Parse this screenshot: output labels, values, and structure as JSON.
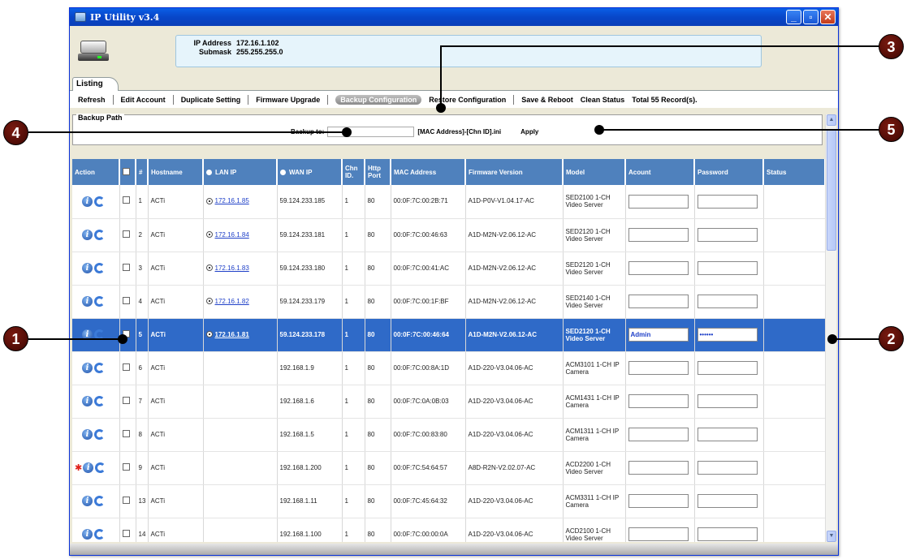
{
  "window": {
    "title": "IP Utility v3.4",
    "minimize": "_",
    "maximize": "▫",
    "close": "✕"
  },
  "header": {
    "ip_label": "IP Address",
    "ip_value": "172.16.1.102",
    "mask_label": "Submask",
    "mask_value": "255.255.255.0"
  },
  "tabs": [
    {
      "label": "Listing"
    }
  ],
  "toolbar": {
    "items": [
      {
        "label": "Refresh"
      },
      {
        "label": "Edit Account"
      },
      {
        "label": "Duplicate Setting"
      },
      {
        "label": "Firmware Upgrade"
      },
      {
        "label": "Backup Configuration"
      },
      {
        "label": "Restore Configuration"
      },
      {
        "label": "Save & Reboot"
      },
      {
        "label": "Clean Status"
      }
    ],
    "active_item": "Backup Configuration",
    "total": "Total 55 Record(s)."
  },
  "backup": {
    "legend": "Backup Path",
    "backup_to_label": "Backup to:",
    "backup_to_value": "",
    "suffix": "[MAC Address]-[Chn ID].ini",
    "apply_label": "Apply"
  },
  "table": {
    "headers": [
      "Action",
      "",
      "#",
      "Hostname",
      "LAN IP",
      "WAN IP",
      "Chn ID.",
      "Http Port",
      "MAC Address",
      "Firmware Version",
      "Model",
      "Acount",
      "Password",
      "Status"
    ],
    "rows": [
      {
        "num": "1",
        "host": "ACTi",
        "lan": "172.16.1.85",
        "wan": "59.124.233.185",
        "chn": "1",
        "port": "80",
        "mac": "00:0F:7C:00:2B:71",
        "fw": "A1D-P0V-V1.04.17-AC",
        "model": "SED2100 1-CH Video Server",
        "account": "",
        "password": "",
        "status": "",
        "selected": false,
        "star": false
      },
      {
        "num": "2",
        "host": "ACTi",
        "lan": "172.16.1.84",
        "wan": "59.124.233.181",
        "chn": "1",
        "port": "80",
        "mac": "00:0F:7C:00:46:63",
        "fw": "A1D-M2N-V2.06.12-AC",
        "model": "SED2120 1-CH Video Server",
        "account": "",
        "password": "",
        "status": "",
        "selected": false,
        "star": false
      },
      {
        "num": "3",
        "host": "ACTi",
        "lan": "172.16.1.83",
        "wan": "59.124.233.180",
        "chn": "1",
        "port": "80",
        "mac": "00:0F:7C:00:41:AC",
        "fw": "A1D-M2N-V2.06.12-AC",
        "model": "SED2120 1-CH Video Server",
        "account": "",
        "password": "",
        "status": "",
        "selected": false,
        "star": false
      },
      {
        "num": "4",
        "host": "ACTi",
        "lan": "172.16.1.82",
        "wan": "59.124.233.179",
        "chn": "1",
        "port": "80",
        "mac": "00:0F:7C:00:1F:BF",
        "fw": "A1D-M2N-V2.06.12-AC",
        "model": "SED2140 1-CH Video Server",
        "account": "",
        "password": "",
        "status": "",
        "selected": false,
        "star": false
      },
      {
        "num": "5",
        "host": "ACTi",
        "lan": "172.16.1.81",
        "wan": "59.124.233.178",
        "chn": "1",
        "port": "80",
        "mac": "00:0F:7C:00:46:64",
        "fw": "A1D-M2N-V2.06.12-AC",
        "model": "SED2120 1-CH Video Server",
        "account": "Admin",
        "password": "••••••",
        "status": "",
        "selected": true,
        "star": false
      },
      {
        "num": "6",
        "host": "ACTi",
        "lan": "",
        "wan": "192.168.1.9",
        "chn": "1",
        "port": "80",
        "mac": "00:0F:7C:00:8A:1D",
        "fw": "A1D-220-V3.04.06-AC",
        "model": "ACM3101 1-CH IP Camera",
        "account": "",
        "password": "",
        "status": "",
        "selected": false,
        "star": false
      },
      {
        "num": "7",
        "host": "ACTi",
        "lan": "",
        "wan": "192.168.1.6",
        "chn": "1",
        "port": "80",
        "mac": "00:0F:7C:0A:0B:03",
        "fw": "A1D-220-V3.04.06-AC",
        "model": "ACM1431 1-CH IP Camera",
        "account": "",
        "password": "",
        "status": "",
        "selected": false,
        "star": false
      },
      {
        "num": "8",
        "host": "ACTi",
        "lan": "",
        "wan": "192.168.1.5",
        "chn": "1",
        "port": "80",
        "mac": "00:0F:7C:00:83:80",
        "fw": "A1D-220-V3.04.06-AC",
        "model": "ACM1311 1-CH IP Camera",
        "account": "",
        "password": "",
        "status": "",
        "selected": false,
        "star": false
      },
      {
        "num": "9",
        "host": "ACTi",
        "lan": "",
        "wan": "192.168.1.200",
        "chn": "1",
        "port": "80",
        "mac": "00:0F:7C:54:64:57",
        "fw": "A8D-R2N-V2.02.07-AC",
        "model": "ACD2200 1-CH Video Server",
        "account": "",
        "password": "",
        "status": "",
        "selected": false,
        "star": true
      },
      {
        "num": "13",
        "host": "ACTi",
        "lan": "",
        "wan": "192.168.1.11",
        "chn": "1",
        "port": "80",
        "mac": "00:0F:7C:45:64:32",
        "fw": "A1D-220-V3.04.06-AC",
        "model": "ACM3311 1-CH IP Camera",
        "account": "",
        "password": "",
        "status": "",
        "selected": false,
        "star": false
      },
      {
        "num": "14",
        "host": "ACTi",
        "lan": "",
        "wan": "192.168.1.100",
        "chn": "1",
        "port": "80",
        "mac": "00:0F:7C:00:00:0A",
        "fw": "A1D-220-V3.04.06-AC",
        "model": "ACD2100 1-CH Video Server",
        "account": "",
        "password": "",
        "status": "",
        "selected": false,
        "star": false
      }
    ]
  },
  "callouts": [
    {
      "num": "1"
    },
    {
      "num": "2"
    },
    {
      "num": "3"
    },
    {
      "num": "4"
    },
    {
      "num": "5"
    }
  ],
  "icons": {
    "info": "info-icon",
    "refresh": "refresh-icon",
    "star": "star-icon",
    "app": "device-icon"
  },
  "colors": {
    "header_blue": "#4f81bd",
    "selected_row": "#2f6ac8",
    "titlebar": "#0846c9",
    "callout": "#3c0602"
  }
}
